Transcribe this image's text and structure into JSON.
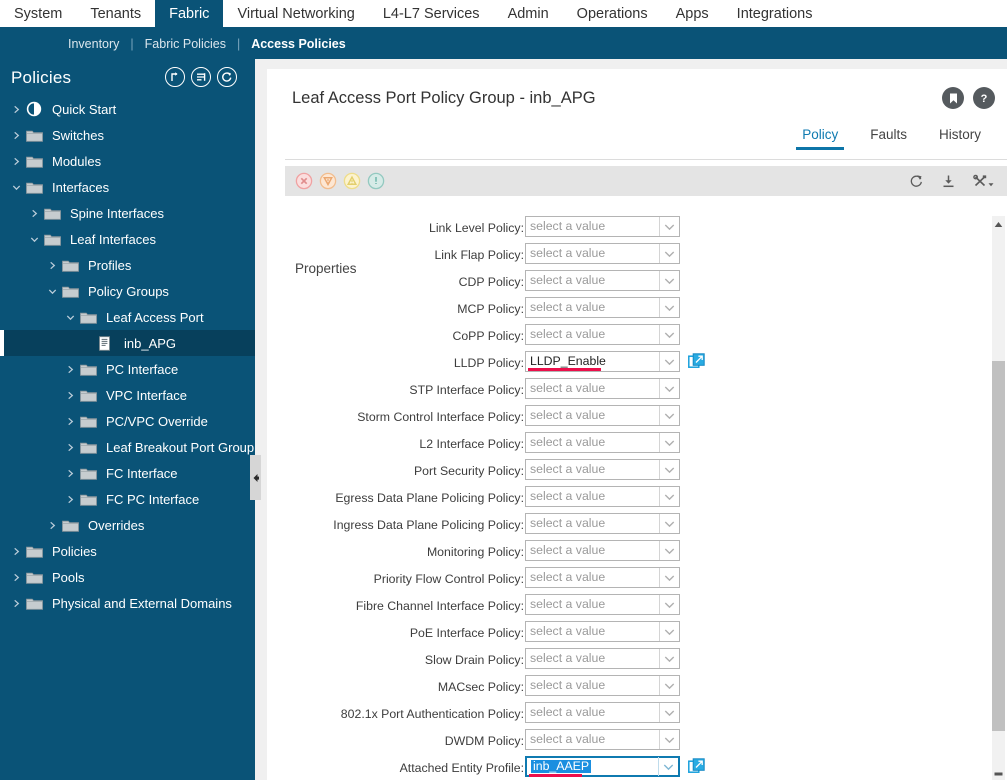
{
  "topnav": {
    "items": [
      {
        "label": "System",
        "active": false
      },
      {
        "label": "Tenants",
        "active": false
      },
      {
        "label": "Fabric",
        "active": true
      },
      {
        "label": "Virtual Networking",
        "active": false
      },
      {
        "label": "L4-L7 Services",
        "active": false
      },
      {
        "label": "Admin",
        "active": false
      },
      {
        "label": "Operations",
        "active": false
      },
      {
        "label": "Apps",
        "active": false
      },
      {
        "label": "Integrations",
        "active": false
      }
    ]
  },
  "subnav": {
    "items": [
      {
        "label": "Inventory",
        "active": false
      },
      {
        "label": "Fabric Policies",
        "active": false
      },
      {
        "label": "Access Policies",
        "active": true
      }
    ],
    "separator": "|"
  },
  "sidebar": {
    "title": "Policies",
    "header_icons": [
      "collapse-all-icon",
      "filter-list-icon",
      "refresh-icon"
    ],
    "tree": [
      {
        "label": "Quick Start",
        "depth": 0,
        "caret": "right",
        "icon": "quickstart-icon",
        "selected": false
      },
      {
        "label": "Switches",
        "depth": 0,
        "caret": "right",
        "icon": "folder-icon",
        "selected": false
      },
      {
        "label": "Modules",
        "depth": 0,
        "caret": "right",
        "icon": "folder-icon",
        "selected": false
      },
      {
        "label": "Interfaces",
        "depth": 0,
        "caret": "down",
        "icon": "folder-icon",
        "selected": false
      },
      {
        "label": "Spine Interfaces",
        "depth": 1,
        "caret": "right",
        "icon": "folder-icon",
        "selected": false
      },
      {
        "label": "Leaf Interfaces",
        "depth": 1,
        "caret": "down",
        "icon": "folder-icon",
        "selected": false
      },
      {
        "label": "Profiles",
        "depth": 2,
        "caret": "right",
        "icon": "folder-icon",
        "selected": false
      },
      {
        "label": "Policy Groups",
        "depth": 2,
        "caret": "down",
        "icon": "folder-icon",
        "selected": false
      },
      {
        "label": "Leaf Access Port",
        "depth": 3,
        "caret": "down",
        "icon": "folder-icon",
        "selected": false
      },
      {
        "label": "inb_APG",
        "depth": 4,
        "caret": "none",
        "icon": "document-icon",
        "selected": true
      },
      {
        "label": "PC Interface",
        "depth": 3,
        "caret": "right",
        "icon": "folder-icon",
        "selected": false
      },
      {
        "label": "VPC Interface",
        "depth": 3,
        "caret": "right",
        "icon": "folder-icon",
        "selected": false
      },
      {
        "label": "PC/VPC Override",
        "depth": 3,
        "caret": "right",
        "icon": "folder-icon",
        "selected": false
      },
      {
        "label": "Leaf Breakout Port Group",
        "depth": 3,
        "caret": "right",
        "icon": "folder-icon",
        "selected": false
      },
      {
        "label": "FC Interface",
        "depth": 3,
        "caret": "right",
        "icon": "folder-icon",
        "selected": false
      },
      {
        "label": "FC PC Interface",
        "depth": 3,
        "caret": "right",
        "icon": "folder-icon",
        "selected": false
      },
      {
        "label": "Overrides",
        "depth": 2,
        "caret": "right",
        "icon": "folder-icon",
        "selected": false
      },
      {
        "label": "Policies",
        "depth": 0,
        "caret": "right",
        "icon": "folder-icon",
        "selected": false
      },
      {
        "label": "Pools",
        "depth": 0,
        "caret": "right",
        "icon": "folder-icon",
        "selected": false
      },
      {
        "label": "Physical and External Domains",
        "depth": 0,
        "caret": "right",
        "icon": "folder-icon",
        "selected": false
      }
    ]
  },
  "content": {
    "page_title": "Leaf Access Port Policy Group - inb_APG",
    "header_icons": [
      "bookmark-icon",
      "help-icon"
    ],
    "tabs": [
      {
        "label": "Policy",
        "active": true
      },
      {
        "label": "Faults",
        "active": false
      },
      {
        "label": "History",
        "active": false
      }
    ],
    "toolbar": {
      "fault_icons": [
        {
          "name": "fault-critical-icon",
          "color": "#f5a0a0"
        },
        {
          "name": "fault-major-icon",
          "color": "#f5c49a"
        },
        {
          "name": "fault-minor-icon",
          "color": "#f2e09a"
        },
        {
          "name": "fault-warning-icon",
          "color": "#a8d8cf"
        }
      ],
      "right_icons": [
        "refresh-icon",
        "download-icon",
        "actions-tools-icon"
      ]
    },
    "properties_label": "Properties",
    "placeholder": "select a value",
    "fields": [
      {
        "label": "Link Level Policy:",
        "value": "",
        "focused": false,
        "link": false
      },
      {
        "label": "Link Flap Policy:",
        "value": "",
        "focused": false,
        "link": false
      },
      {
        "label": "CDP Policy:",
        "value": "",
        "focused": false,
        "link": false
      },
      {
        "label": "MCP Policy:",
        "value": "",
        "focused": false,
        "link": false
      },
      {
        "label": "CoPP Policy:",
        "value": "",
        "focused": false,
        "link": false
      },
      {
        "label": "LLDP Policy:",
        "value": "LLDP_Enable",
        "focused": false,
        "link": true
      },
      {
        "label": "STP Interface Policy:",
        "value": "",
        "focused": false,
        "link": false
      },
      {
        "label": "Storm Control Interface Policy:",
        "value": "",
        "focused": false,
        "link": false
      },
      {
        "label": "L2 Interface Policy:",
        "value": "",
        "focused": false,
        "link": false
      },
      {
        "label": "Port Security Policy:",
        "value": "",
        "focused": false,
        "link": false
      },
      {
        "label": "Egress Data Plane Policing Policy:",
        "value": "",
        "focused": false,
        "link": false
      },
      {
        "label": "Ingress Data Plane Policing Policy:",
        "value": "",
        "focused": false,
        "link": false
      },
      {
        "label": "Monitoring Policy:",
        "value": "",
        "focused": false,
        "link": false
      },
      {
        "label": "Priority Flow Control Policy:",
        "value": "",
        "focused": false,
        "link": false
      },
      {
        "label": "Fibre Channel Interface Policy:",
        "value": "",
        "focused": false,
        "link": false
      },
      {
        "label": "PoE Interface Policy:",
        "value": "",
        "focused": false,
        "link": false
      },
      {
        "label": "Slow Drain Policy:",
        "value": "",
        "focused": false,
        "link": false
      },
      {
        "label": "MACsec Policy:",
        "value": "",
        "focused": false,
        "link": false
      },
      {
        "label": "802.1x Port Authentication Policy:",
        "value": "",
        "focused": false,
        "link": false
      },
      {
        "label": "DWDM Policy:",
        "value": "",
        "focused": false,
        "link": false
      },
      {
        "label": "Attached Entity Profile:",
        "value": "inb_AAEP",
        "focused": true,
        "link": true,
        "text_selected": true
      }
    ]
  },
  "colors": {
    "brand_blue": "#0a5377",
    "accent_blue": "#0f7ab0",
    "selection_blue": "#1a8fe0",
    "error_underline": "#ec0f4b",
    "sidebar_selected": "#07405c"
  }
}
